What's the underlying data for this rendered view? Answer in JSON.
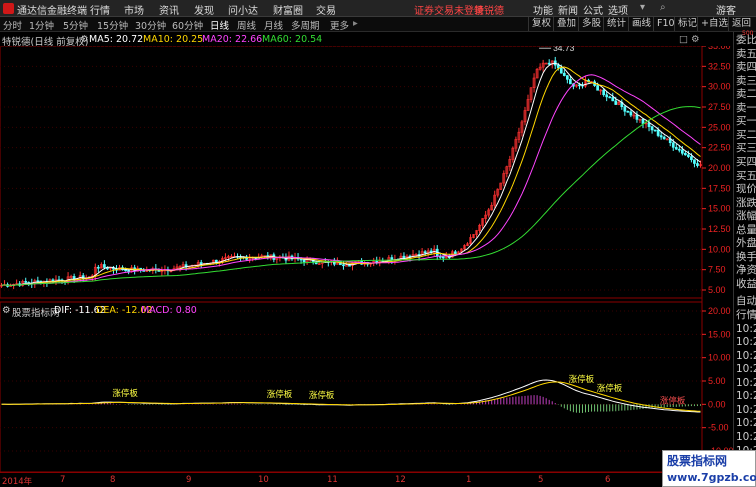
{
  "app": {
    "title": "通达信金融终端",
    "menus": [
      "行情",
      "市场",
      "资讯",
      "发现",
      "问小达",
      "财富圈",
      "交易"
    ],
    "login_notice": "证券交易未登录",
    "stock_name": "特锐德",
    "right_menus": [
      "功能",
      "新闻",
      "公式",
      "选项"
    ],
    "guest": "游客"
  },
  "toolbar": {
    "periods": [
      "分时",
      "1分钟",
      "5分钟",
      "15分钟",
      "30分钟",
      "60分钟",
      "日线",
      "周线",
      "月线",
      "多周期",
      "更多"
    ],
    "active_period": "日线",
    "right_buttons": [
      "复权",
      "叠加",
      "多股",
      "统计",
      "画线",
      "F10",
      "标记",
      "+自选",
      "返回"
    ]
  },
  "main_chart": {
    "label": "特锐德(日线 前复权)",
    "ma": [
      {
        "name": "MA5",
        "value": "20.72",
        "color": "#ffffff"
      },
      {
        "name": "MA10",
        "value": "20.25",
        "color": "#ffd700"
      },
      {
        "name": "MA20",
        "value": "22.66",
        "color": "#ff44ff"
      },
      {
        "name": "MA60",
        "value": "20.54",
        "color": "#33dd33"
      }
    ],
    "high_label": "34.73",
    "y_ticks": [
      "35.00",
      "32.50",
      "30.00",
      "27.50",
      "25.00",
      "22.50",
      "20.00",
      "17.50",
      "15.00",
      "12.50",
      "10.00",
      "7.50",
      "5.00"
    ]
  },
  "indicator": {
    "label": "股票指标网",
    "dif": "DIF: -11.62",
    "dea": "DEA: -12.02",
    "macd": "MACD: 0.80",
    "y_ticks": [
      "20.00",
      "15.00",
      "10.00",
      "5.00",
      "0.00",
      "-5.00",
      "-10.00"
    ],
    "annotations": [
      "涨停板",
      "涨停板",
      "涨停板",
      "涨停板",
      "涨停板",
      "涨停板"
    ]
  },
  "right_panel": {
    "items": [
      "委比",
      "卖五",
      "卖四",
      "卖三",
      "卖二",
      "卖一",
      "买一",
      "买二",
      "买三",
      "买四",
      "买五",
      "现价",
      "涨跌",
      "涨幅",
      "总量",
      "外盘",
      "换手",
      "净资",
      "收益",
      "自动",
      "行情",
      "10:2",
      "10:2",
      "10:2",
      "10:2",
      "10:2",
      "10:2",
      "10:2",
      "10:2",
      "10:2",
      "10:2",
      "10:2"
    ],
    "corner": "500"
  },
  "timeline": {
    "labels": [
      "2014年",
      "7",
      "8",
      "9",
      "10",
      "11",
      "12",
      "1",
      "5",
      "6"
    ]
  },
  "watermark": {
    "line1": "股票指标网",
    "line2": "www.7gpzb.com"
  },
  "colors": {
    "up": "#ff3232",
    "down": "#54ffff",
    "ma5": "#ffffff",
    "ma10": "#ffd700",
    "ma20": "#ff44ff",
    "ma60": "#33dd33",
    "annotation": "#ffff44"
  }
}
